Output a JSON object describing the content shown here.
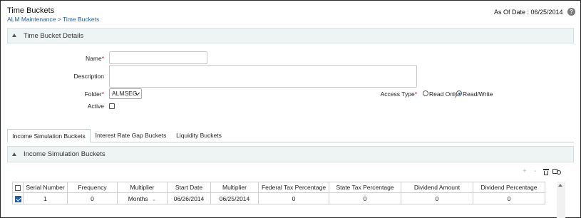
{
  "header": {
    "title": "Time Buckets",
    "breadcrumb": "ALM Maintenance > Time Buckets",
    "as_of_date": "As Of Date : 06/25/2014",
    "help_icon": "question-circle-icon",
    "help_glyph": "?"
  },
  "details_section": {
    "title": "Time Bucket Details",
    "name": {
      "label": "Name",
      "required_mark": "*",
      "value": ""
    },
    "description": {
      "label": "Description",
      "value": ""
    },
    "folder": {
      "label": "Folder",
      "required_mark": "*",
      "value": "ALMSEG"
    },
    "active": {
      "label": "Active",
      "checked": false
    },
    "access_type": {
      "label": "Access Type",
      "required_mark": "*",
      "options": [
        "Read Only",
        "Read/Write"
      ],
      "selected": "Read/Write"
    }
  },
  "tabs": [
    {
      "label": "Income Simulation Buckets",
      "active": true
    },
    {
      "label": "Interest Rate Gap Buckets",
      "active": false
    },
    {
      "label": "Liquidity Buckets",
      "active": false
    }
  ],
  "grid_section": {
    "title": "Income Simulation Buckets",
    "toolbar": {
      "add_glyph": "+",
      "remove_glyph": "-",
      "delete_icon": "trash-icon",
      "find_icon": "find-icon"
    },
    "columns": [
      "Serial Number",
      "Frequency",
      "Multiplier",
      "Start Date",
      "Multiplier",
      "Federal Tax Percentage",
      "State Tax Percentage",
      "Dividend Amount",
      "Dividend Percentage"
    ],
    "rows": [
      {
        "selected": true,
        "serial_number": "1",
        "frequency": "0",
        "multiplier": "Months",
        "start_date": "06/26/2014",
        "multiplier2": "06/25/2014",
        "federal_tax": "0",
        "state_tax": "0",
        "dividend_amount": "0",
        "dividend_percentage": "0"
      }
    ]
  },
  "colors": {
    "accent": "#1a5fb4",
    "section_bg": "#eef3f3",
    "link": "#1d5fa8",
    "required": "#d0021b"
  }
}
